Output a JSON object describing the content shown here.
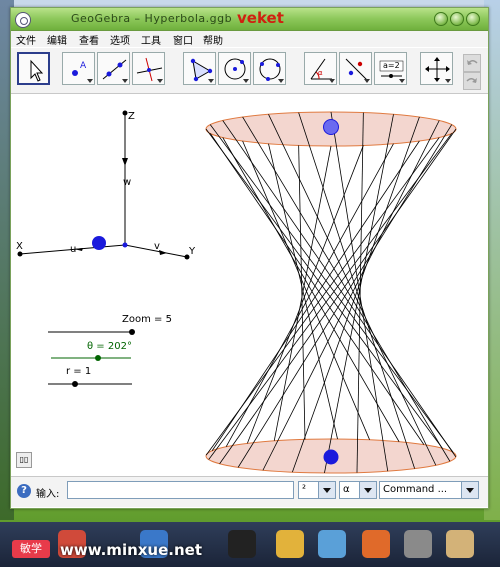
{
  "window": {
    "title": "GeoGebra – Hyperbola.ggb",
    "title_tag": "veket"
  },
  "menu": [
    "文件",
    "编辑",
    "查看",
    "选项",
    "工具",
    "窗口",
    "帮助"
  ],
  "tools": [
    "move",
    "point",
    "line-through-two-points",
    "perpendicular-line",
    "polygon",
    "circle-with-center",
    "circle-through-three-points",
    "angle",
    "reflect-about-line",
    "slider",
    "move-graphics-view"
  ],
  "slider_tool_label": "a=2",
  "axes": {
    "x": "X",
    "y": "Y",
    "z": "Z",
    "u": "u",
    "v": "v",
    "w": "w"
  },
  "sliders": [
    {
      "label": "Zoom = 5",
      "color": "#000000"
    },
    {
      "label": "θ = 202°",
      "color": "#006400"
    },
    {
      "label": "r = 1",
      "color": "#000000"
    }
  ],
  "input_bar": {
    "label": "输入:",
    "value": "",
    "precision": "²",
    "greek": "α",
    "command": "Command ..."
  },
  "watermark": "www.minxue.net",
  "watermark_logo": "敏学",
  "colors": {
    "titlebar": "#8cc75a",
    "slider_theta": "#006400",
    "point_blue": "#1a1adc",
    "ellipse_fill": "#f3d6cf",
    "ellipse_stroke": "#e07a40"
  }
}
